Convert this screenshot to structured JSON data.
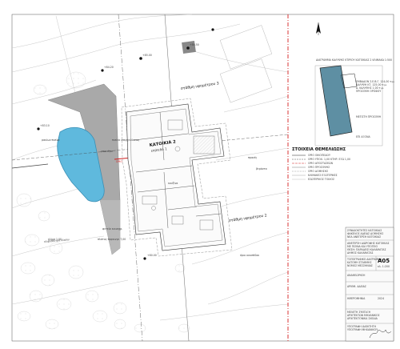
{
  "plan": {
    "levels": {
      "level_3": "στάθμη υψομέτρου 3",
      "level_2": "στάθμη υψομέτρου 2"
    },
    "house_label": "ΚΑΤΟΙΚΙΑ 2",
    "house_sublabel": "επίπεδο 1",
    "pool_note_1": "πισίνα υπερχειλίσεως",
    "pool_note_2": "μπανιέρα",
    "pool_note_3": "ρακίων πισίνα",
    "kitchen_note": "κουζίνα",
    "terrace_note": "βεράντα",
    "slope_note_1": "πρανές",
    "slope_note_2": "όριο οικοπέδου",
    "slope_note_3": "κλίμα 1,00",
    "slope_note_4": "ολιβόδεντρα ελαίου",
    "slope_note_5": "φυτεία κοινοχρ.",
    "slope_note_6": "πλάτος παρκινγκ 7,00",
    "limit_mark": "ΟΡΙΟ",
    "elev_1": "+85.00",
    "elev_2": "+86.50",
    "elev_3": "+84.20",
    "elev_4": "+83.10",
    "elev_5": "+80.00"
  },
  "inset": {
    "title": "ΔΙΑΓΡΑΜΜΑ ΚΑΛΥΨΗΣ ΚΤΙΡΙΟΥ ΚΑΤΟΙΚΙΑΣ 2 ΚΛΙΜΑΚΑ 1:500",
    "note_1": "ΕΜΒΑΔΟΝ Σ.Ε.Β.Γ. 124,00 τ.μ.",
    "note_2": "ΚΑΛΥΨΗ ΚΤ. 125,00 τ.μ.",
    "note_3": "Δ. ΚΑΛΥΨΗΣ 1,00 τ.μ.",
    "note_4": "ΠΡΟΣΟΨΗ ΟΡΟΦΟΥ",
    "note_5": "ΜΕΓΙΣΤΗ ΠΡΟΣΟΨΗ",
    "note_6": "ΕΠΙ ΑΞΟΝΑ"
  },
  "legend": {
    "title": "ΣΤΟΙΧΕΙΑ ΘΕΜΕΛΙΩΣΗΣ",
    "line_1": "ΟΡΙΟ ΟΙΚΟΠΕΔΟΥ",
    "line_2": "ΟΡΙΟ ΥΠΟΧ. 1,00 ΚΤΗΡ. ΕΞΩ 1,00",
    "line_3": "ΟΡΙΟ ΑΠΟΣΤΑΣΕΩΝ",
    "line_4": "ΟΡΙΟ ΠΡΟΣΟΨΗΣ",
    "line_5": "ΟΡΙΟ ΔΟΜΗΣΗΣ",
    "line_6": "ΚΛΙΜΑΚΕΣ ΕΞΩΤΕΡΙΚΕΣ",
    "line_7": "ΕΣΩΤΕΡΙΚΟΣ ΤΟΙΧΟΣ"
  },
  "titleblock": {
    "owner_1": "ΣΥΝΙΔΙΟΚΤΗΤΕΣ ΚΑΤΟΙΚΙΑΣ",
    "owner_2": "ΦΑΚΕΛΟΣ ΑΔΕΙΑΣ ΔΟΜΗΣΗΣ",
    "owner_3": "ΝΕΑ ΑΝΕΓΕΡΣΗ ΚΑΤΟΙΚΙΑΣ",
    "project_1": "ΑΝΕΓΕΡΣΗ ΔΙΩΡΟΦΗΣ ΚΑΤΟΙΚΙΑΣ",
    "project_2": "ΜΕ ΠΙΣΙΝΑ ΚΑΙ ΥΠΟΓΕΙΟ",
    "location_1": "ΘΕΣΗ: ΠΑΡΑΔΕΙΣΙ ΚΑΛΑΜΑΤΑΣ",
    "location_2": "ΔΗΜΟΣ ΚΑΛΑΜΑΤΑΣ",
    "location_3": "ΝΟΜΟΣ ΜΕΣΣΗΝΙΑΣ",
    "location_4": "ΑΡΙΘΜ. ΑΔΕΙΑΣ",
    "drawing_label": "ΤΟΠΟΓΡΑΦΙΚΟ ΔΙΑΓΡΑΜΜΑ",
    "drawing_sub": "ΚΑΤΟΨΗ ΣΤΑΘΜΗΣ",
    "sheet_code": "Α05",
    "sheet_scale": "κλ. 1:200",
    "revision": "ΑΝΑΘΕΩΡΗΣΗ",
    "designer_1": "ΜΕΛΕΤΗ ΣΥΝΤΑΞΗ",
    "designer_2": "ΑΡΧΙΤΕΚΤΩΝ ΜΗΧΑΝΙΚΟΣ",
    "designer_3": "ΑΡΧΙΤΕΚΤΟΝΙΚΑ ΣΧΕΔΙΑ",
    "date_label": "ΗΜΕΡΟΜΗΝΙΑ",
    "date_value": "2024",
    "signature_1": "ΥΠΟΓΡΑΦΗ ΙΔΙΟΚΤΗΤΗ",
    "signature_2": "ΥΠΟΓΡΑΦΗ ΜΗΧΑΝΙΚΟΥ"
  }
}
